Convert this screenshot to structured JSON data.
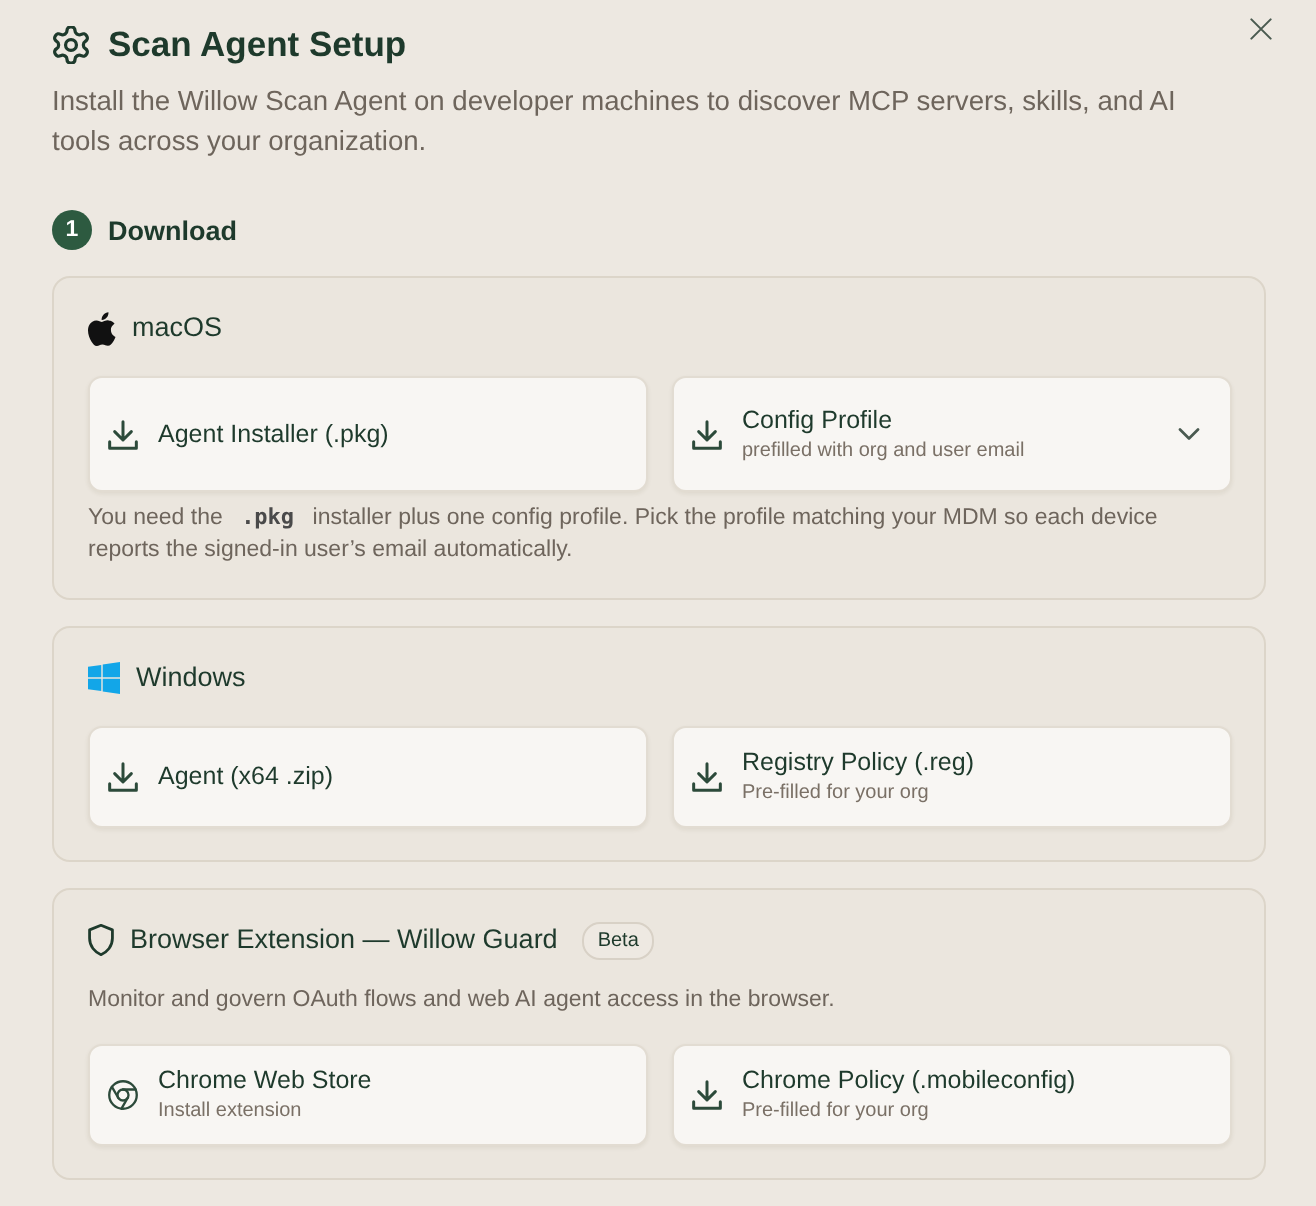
{
  "dialog": {
    "title": "Scan Agent Setup",
    "description": "Install the Willow Scan Agent on developer machines to discover MCP servers, skills, and AI tools across your organization."
  },
  "steps": [
    {
      "number": "1",
      "title": "Download",
      "panels": [
        {
          "kind": "macos",
          "name": "macOS",
          "buttons": [
            {
              "kind": "download",
              "label": "Agent Installer (.pkg)",
              "dropdown": false
            },
            {
              "kind": "download",
              "label": "Config Profile",
              "sublabel": "prefilled with org and user email",
              "dropdown": true
            }
          ],
          "note": [
            {
              "kind": "text",
              "text": "You need the "
            },
            {
              "kind": "code",
              "text": ".pkg"
            },
            {
              "kind": "text",
              "text": " installer plus one config profile. Pick the profile matching your MDM so each device reports the signed-in user’s email automatically."
            }
          ]
        },
        {
          "kind": "windows",
          "name": "Windows",
          "buttons": [
            {
              "kind": "download",
              "label": "Agent (x64 .zip)",
              "dropdown": false
            },
            {
              "kind": "download",
              "label": "Registry Policy (.reg)",
              "sublabel": "Pre-filled for your org",
              "dropdown": false
            }
          ]
        },
        {
          "kind": "browser",
          "name": "Browser Extension — Willow Guard",
          "badge": "Beta",
          "description": "Monitor and govern OAuth flows and web AI agent access in the browser.",
          "buttons": [
            {
              "kind": "store",
              "label": "Chrome Web Store",
              "sublabel": "Install extension",
              "dropdown": false
            },
            {
              "kind": "download",
              "label": "Chrome Policy (.mobileconfig)",
              "sublabel": "Pre-filled for your org",
              "dropdown": false
            }
          ]
        }
      ]
    }
  ]
}
